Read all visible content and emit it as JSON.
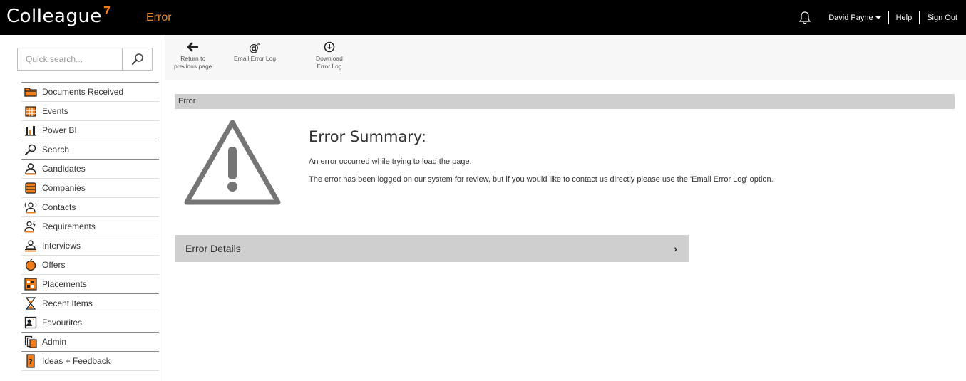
{
  "header": {
    "logo_text": "Colleague",
    "logo_sup": "7",
    "page_label": "Error",
    "user_name": "David Payne",
    "help_label": "Help",
    "signout_label": "Sign Out"
  },
  "search": {
    "placeholder": "Quick search..."
  },
  "sidebar": {
    "items": [
      {
        "label": "Documents Received",
        "icon": "folder-icon"
      },
      {
        "label": "Events",
        "icon": "calendar-icon"
      },
      {
        "label": "Power BI",
        "icon": "bar-chart-icon"
      },
      {
        "label": "Search",
        "icon": "search-icon"
      },
      {
        "label": "Candidates",
        "icon": "person-icon"
      },
      {
        "label": "Companies",
        "icon": "building-icon"
      },
      {
        "label": "Contacts",
        "icon": "contact-icon"
      },
      {
        "label": "Requirements",
        "icon": "requirement-icon"
      },
      {
        "label": "Interviews",
        "icon": "interview-icon"
      },
      {
        "label": "Offers",
        "icon": "offer-icon"
      },
      {
        "label": "Placements",
        "icon": "placement-icon"
      },
      {
        "label": "Recent Items",
        "icon": "hourglass-icon"
      },
      {
        "label": "Favourites",
        "icon": "favourites-icon"
      },
      {
        "label": "Admin",
        "icon": "admin-icon"
      },
      {
        "label": "Ideas + Feedback",
        "icon": "ideas-icon"
      }
    ]
  },
  "toolbar": {
    "return_line1": "Return to",
    "return_line2": "previous page",
    "email_label": "Email Error Log",
    "download_line1": "Download",
    "download_line2": "Error Log"
  },
  "main": {
    "section_title": "Error",
    "summary_title": "Error Summary:",
    "message_1": "An error occurred while trying to load the page.",
    "message_2": "The error has been logged on our system for review, but if you would like to contact us directly please use the 'Email Error Log' option.",
    "details_label": "Error Details"
  },
  "colors": {
    "accent": "#f07d1a",
    "topbar": "#000000",
    "section_bar": "#cfcfcf",
    "warning_icon": "#757575"
  }
}
